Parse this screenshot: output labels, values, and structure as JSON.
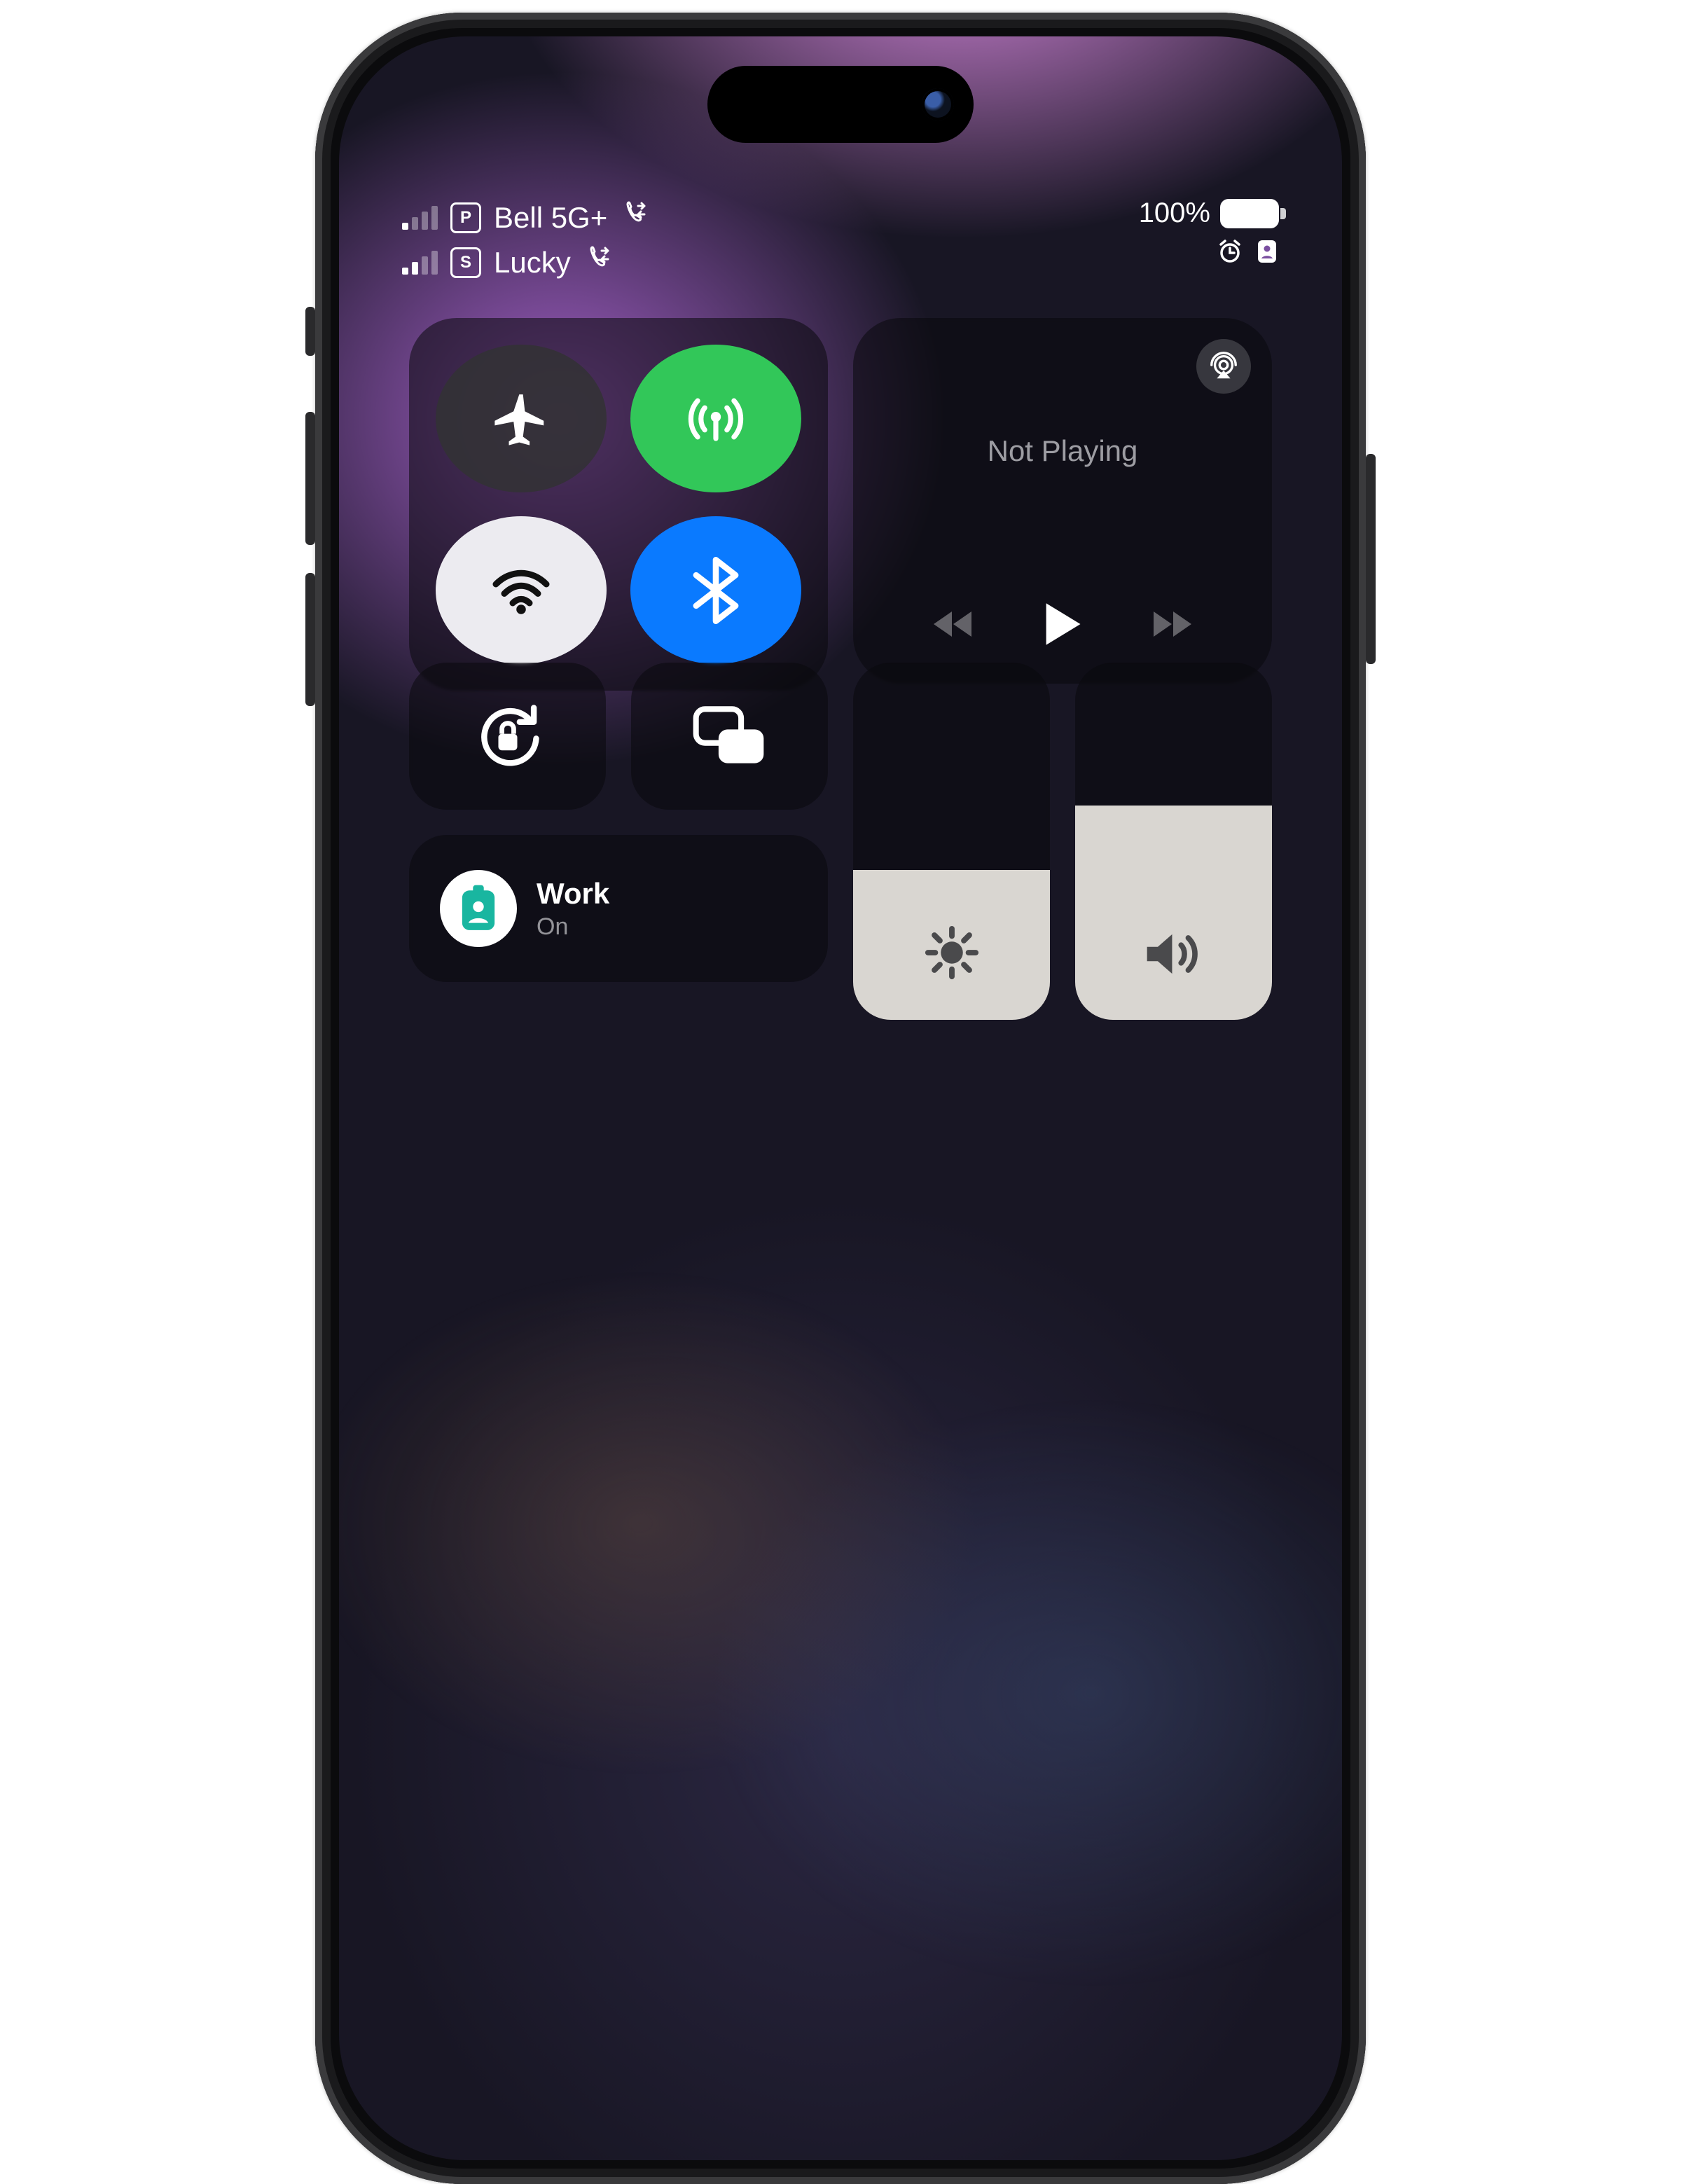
{
  "status": {
    "sim1": {
      "badge": "P",
      "carrier": "Bell 5G+",
      "signal_bars": 1
    },
    "sim2": {
      "badge": "S",
      "carrier": "Lucky",
      "signal_bars": 2
    },
    "battery_pct": "100%"
  },
  "connectivity": {
    "airplane_on": false,
    "cellular_on": true,
    "wifi_on": true,
    "bluetooth_on": true
  },
  "media": {
    "now_playing": "Not Playing"
  },
  "focus": {
    "name": "Work",
    "state": "On"
  },
  "sliders": {
    "brightness_pct": 42,
    "volume_pct": 60
  },
  "colors": {
    "green": "#32c759",
    "blue": "#0a7aff",
    "teal_badge": "#19b6a0"
  }
}
